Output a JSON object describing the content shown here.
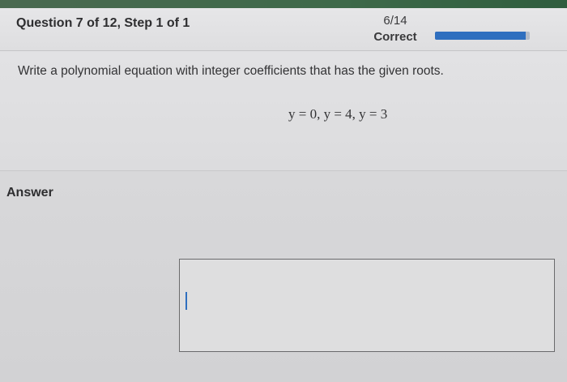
{
  "header": {
    "question_label": "Question 7 of 12, Step 1 of 1",
    "score_fraction": "6/14",
    "score_status": "Correct",
    "progress_fraction": 0.96
  },
  "question": {
    "prompt": "Write a polynomial equation with integer coefficients that has the given roots.",
    "roots_equation": "y = 0, y = 4, y = 3"
  },
  "answer": {
    "label": "Answer",
    "value": ""
  },
  "colors": {
    "accent": "#2f6fbf",
    "topbar": "#3e6a4a"
  }
}
